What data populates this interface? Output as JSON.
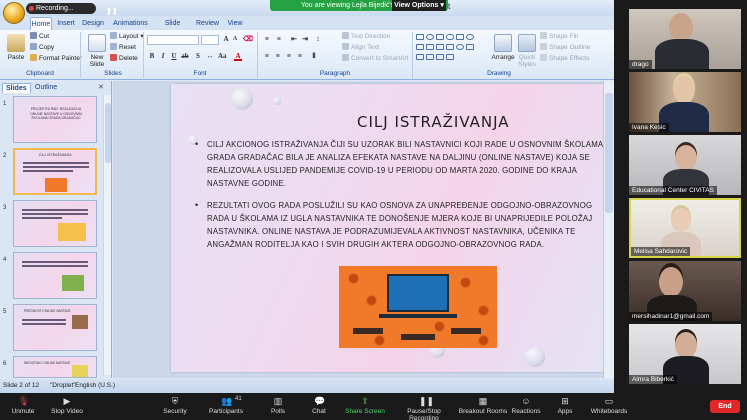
{
  "share_banner": {
    "text": "You are viewing Lejla Bijedić's screen",
    "view_options": "View Options ▾"
  },
  "ppt": {
    "recording_label": "Recording...",
    "title_fragment": "t",
    "tabs": [
      "Home",
      "Insert",
      "Design",
      "Animations",
      "Slide Show",
      "Review",
      "View"
    ],
    "clipboard": {
      "paste": "Paste",
      "cut": "Cut",
      "copy": "Copy",
      "format_painter": "Format Painter",
      "label": "Clipboard"
    },
    "slides_group": {
      "new_slide": "New Slide",
      "layout": "Layout",
      "reset": "Reset",
      "delete": "Delete",
      "label": "Slides"
    },
    "font_group": {
      "label": "Font"
    },
    "paragraph_group": {
      "text_direction": "Text Direction",
      "align_text": "Align Text",
      "convert_smartart": "Convert to SmartArt",
      "label": "Paragraph"
    },
    "drawing_group": {
      "arrange": "Arrange",
      "quick_styles": "Quick Styles",
      "shape_fill": "Shape Fill",
      "shape_outline": "Shape Outline",
      "shape_effects": "Shape Effects",
      "label": "Drawing"
    },
    "pane_tabs": {
      "slides": "Slides",
      "outline": "Outline"
    },
    "thumb_numbers": [
      "1",
      "2",
      "3",
      "4",
      "5",
      "6"
    ],
    "thumb_texts": {
      "t1": "PROJEKTNI RAD: REALIZACIJA ONLINE NASTAVE U OSNOVNIM ŠKOLAMA GRADA GRADAČAC",
      "t2": "CILJ ISTRAŽIVANJA",
      "t5": "PREDNOSTI ONLINE NASTAVE",
      "t6": "NEDOSTACI ONLINE NASTAVE"
    },
    "slide": {
      "title": "CILJ ISTRAŽIVANJA",
      "bullets": [
        "Cilj akcionog istraživanja čiji su uzorak bili nastavnici koji rade u osnovnim školama grada Gradačac bila je analiza  efekata nastave na daljinu (online nastave) koja se realizovala uslijed pandemije COVID-19 u periodu od marta 2020. godine do kraja nastavne godine.",
        "Rezultati ovog rada poslužili su kao osnova za unapređenje odgojno-obrazovnog rada u školama iz ugla nastavnika te donošenje mjera koje bi unaprijedile položaj nastavnika. Online nastava je podrazumijevala aktivnost nastavnika, učenika te angažman roditelja kao i svih drugih aktera odgojno-obrazovnog rada."
      ]
    },
    "status": {
      "slide_pos": "Slide 2 of 12",
      "theme": "\"Droplet\"",
      "language": "English (U.S.)"
    }
  },
  "participants": [
    {
      "name": "drago"
    },
    {
      "name": "Ivana Kesic"
    },
    {
      "name": "Educational Center CIVITAS"
    },
    {
      "name": "Melisa Sahdarovic"
    },
    {
      "name": "mersihadinar1@gmail.com"
    },
    {
      "name": "Almra Biberkić"
    }
  ],
  "toolbar": {
    "buttons": [
      "Unmute",
      "Stop Video",
      "Security",
      "Participants",
      "Polls",
      "Chat",
      "Share Screen",
      "Pause/Stop Recording",
      "Breakout Rooms",
      "Reactions",
      "Apps",
      "Whiteboards"
    ],
    "participants_count": "41",
    "end": "End"
  }
}
